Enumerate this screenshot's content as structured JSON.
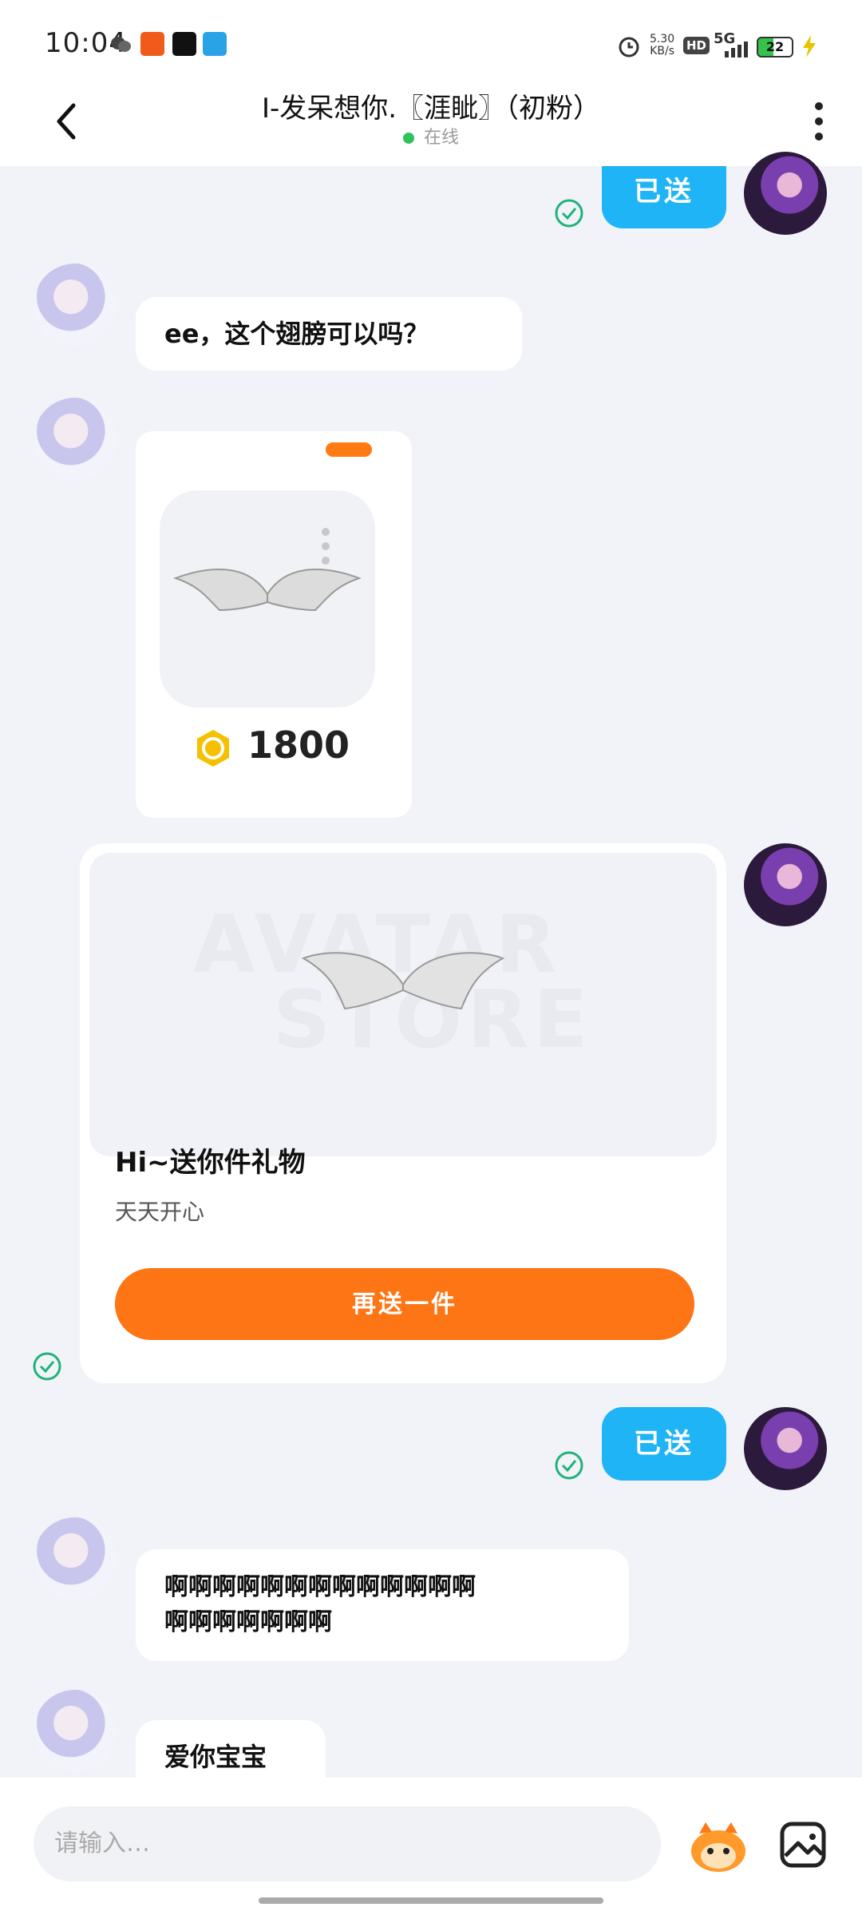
{
  "status_bar": {
    "time": "10:04",
    "net_speed": "5.30",
    "net_unit": "KB/s",
    "hd": "HD",
    "network": "5G",
    "battery": "22"
  },
  "header": {
    "title": "I-发呆想你.〖涯眦〗（初粉）",
    "status": "在线"
  },
  "messages": {
    "sent_1": "已送",
    "recv_1": "ee，这个翅膀可以吗？",
    "gift_price": "1800",
    "present_watermark_1": "AVATAR",
    "present_watermark_2": "STORE",
    "present_title": "Hi~送你件礼物",
    "present_subtitle": "天天开心",
    "present_button": "再送一件",
    "sent_2": "已送",
    "recv_2_line1": "啊啊啊啊啊啊啊啊啊啊啊啊啊",
    "recv_2_line2": "啊啊啊啊啊啊啊",
    "recv_3": "爱你宝宝"
  },
  "input": {
    "placeholder": "请输入…"
  },
  "colors": {
    "accent_orange": "#fd7514",
    "bubble_blue": "#1fb4f6",
    "online_green": "#2fc15a",
    "check_green": "#1fb27a"
  }
}
